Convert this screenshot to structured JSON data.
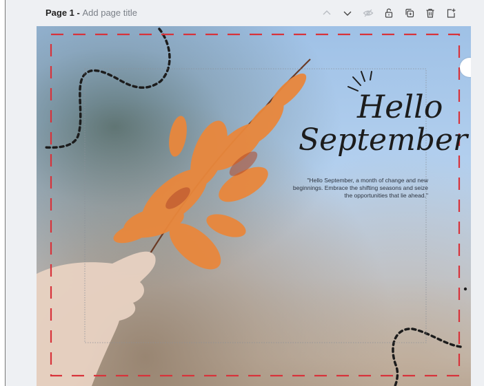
{
  "page_header": {
    "page_number": "Page 1",
    "separator": " - ",
    "title_placeholder": "Add page title"
  },
  "toolbar": {
    "buttons": [
      {
        "icon": "chevron-up-icon",
        "state": "disabled"
      },
      {
        "icon": "chevron-down-icon",
        "state": "enabled"
      },
      {
        "icon": "eye-hide-icon",
        "state": "disabled"
      },
      {
        "icon": "lock-open-icon",
        "state": "enabled"
      },
      {
        "icon": "duplicate-icon",
        "state": "enabled"
      },
      {
        "icon": "trash-icon",
        "state": "enabled"
      },
      {
        "icon": "add-page-icon",
        "state": "enabled"
      }
    ]
  },
  "design": {
    "heading_line1": "Hello",
    "heading_line2": "September",
    "quote": "\"Hello September, a month of change and new beginnings. Embrace the shifting seasons and seize the opportunities that lie ahead.\"",
    "colors": {
      "dashed_border": "#d8323a",
      "leaf": "#e8863a",
      "text": "#1c1c1c"
    }
  }
}
